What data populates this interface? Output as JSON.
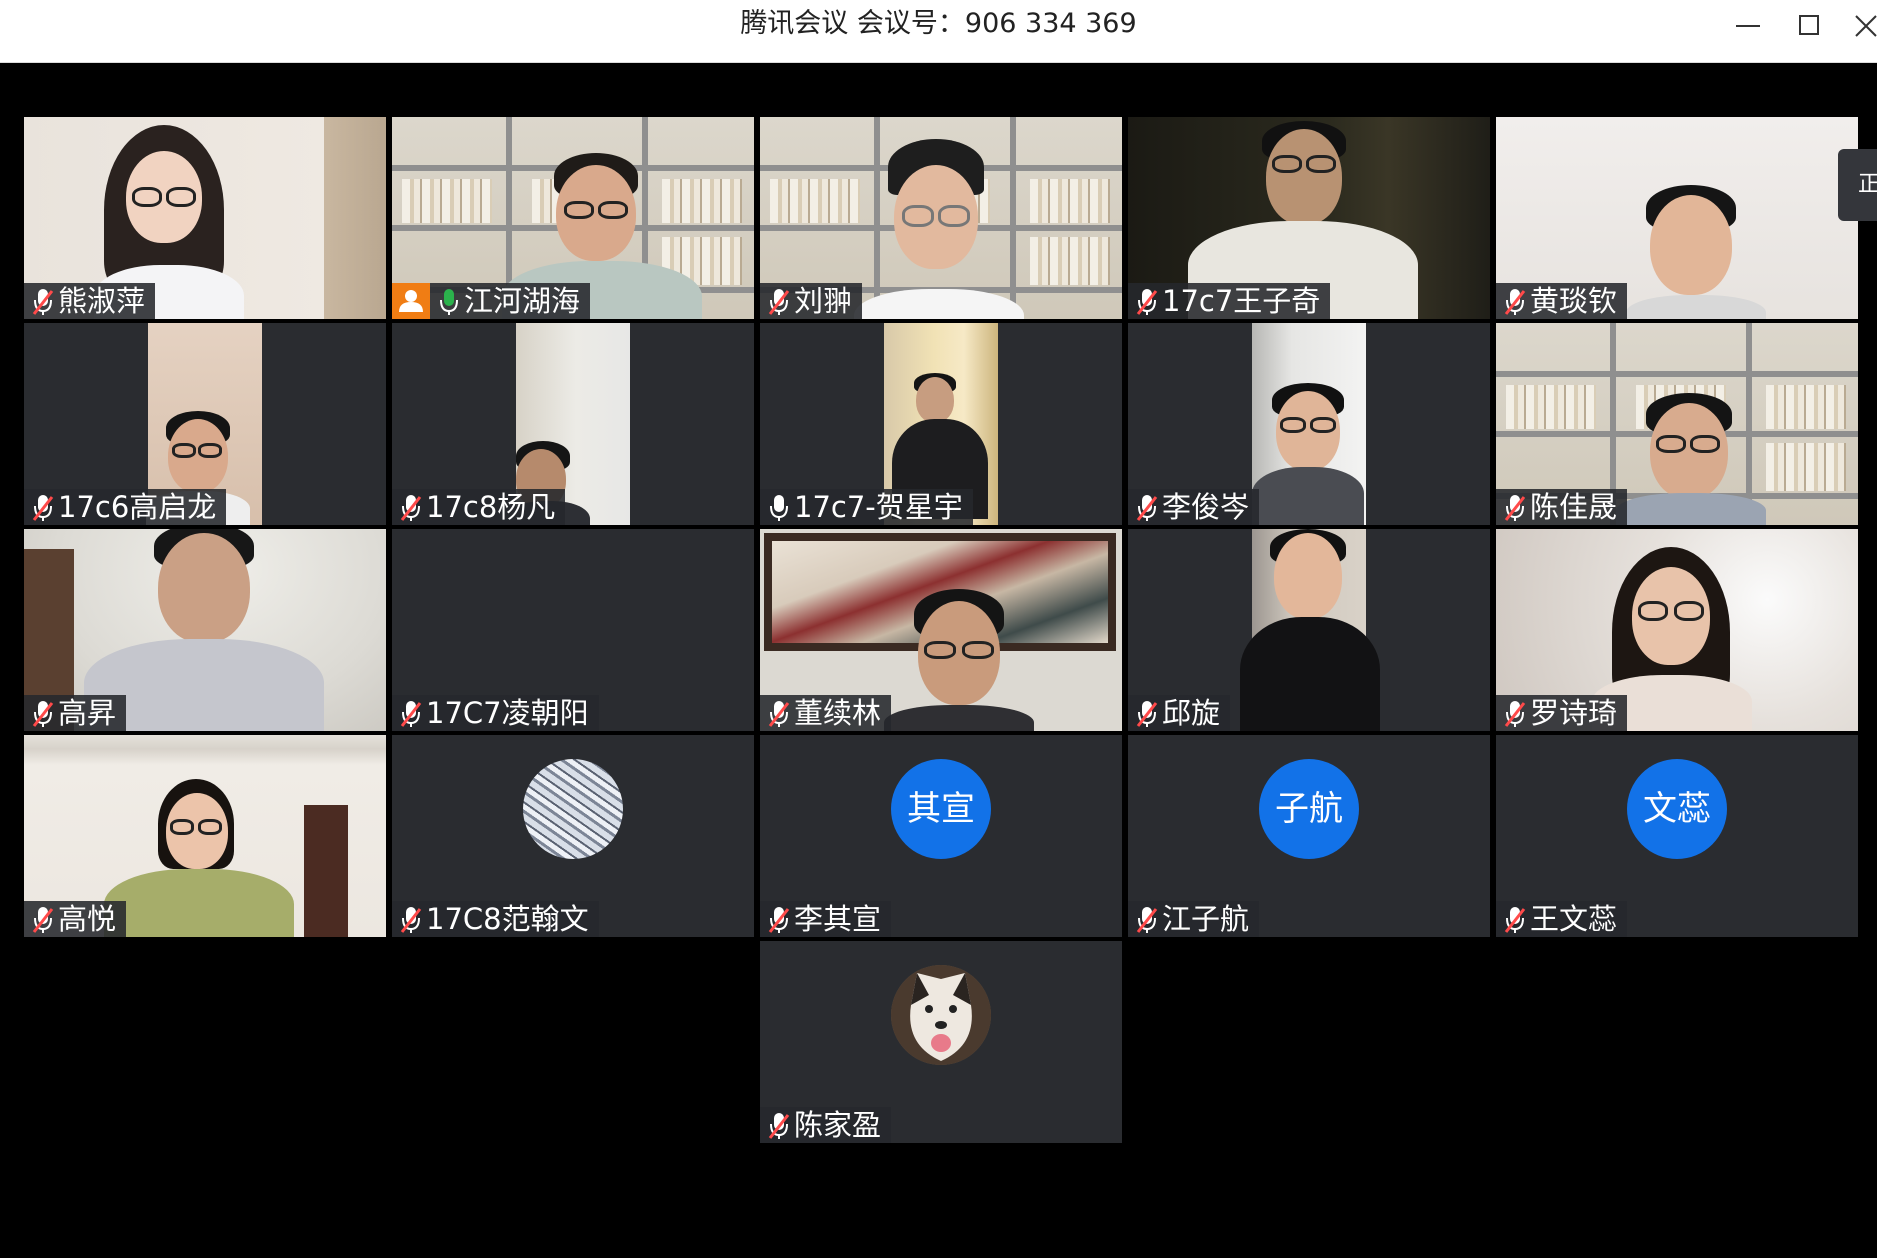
{
  "window": {
    "title": "腾讯会议 会议号：906 334 369",
    "minimize_icon": "minimize-icon",
    "maximize_icon": "maximize-icon",
    "close_icon": "close-icon"
  },
  "side_tab": {
    "label": "正"
  },
  "colors": {
    "tile_bg": "#2a2c30",
    "label_bg": "#26282c",
    "mic_muted": "#ff4a4a",
    "mic_active": "#2bb24c",
    "avatar_blue": "#1272e8",
    "host_orange": "#f07d14",
    "active_border": "#2bb24c"
  },
  "participants": [
    {
      "name": "熊淑萍",
      "mic": "muted"
    },
    {
      "name": "江河湖海",
      "mic": "active",
      "host": true,
      "speaking": true
    },
    {
      "name": "刘翀",
      "mic": "muted"
    },
    {
      "name": "17c7王子奇",
      "mic": "muted"
    },
    {
      "name": "黄琰钦",
      "mic": "muted"
    },
    {
      "name": "17c6高启龙",
      "mic": "muted"
    },
    {
      "name": "17c8杨凡",
      "mic": "muted"
    },
    {
      "name": "17c7-贺星宇",
      "mic": "on"
    },
    {
      "name": "李俊岑",
      "mic": "muted"
    },
    {
      "name": "陈佳晟",
      "mic": "muted"
    },
    {
      "name": "高昇",
      "mic": "muted"
    },
    {
      "name": "17C7凌朝阳",
      "mic": "muted"
    },
    {
      "name": "董续林",
      "mic": "muted"
    },
    {
      "name": "邱旋",
      "mic": "muted"
    },
    {
      "name": "罗诗琦",
      "mic": "muted"
    },
    {
      "name": "高悦",
      "mic": "muted"
    },
    {
      "name": "17C8范翰文",
      "mic": "muted",
      "avatar": "silver-image"
    },
    {
      "name": "李其宣",
      "mic": "muted",
      "avatar_text": "其宣"
    },
    {
      "name": "江子航",
      "mic": "muted",
      "avatar_text": "子航"
    },
    {
      "name": "王文蕊",
      "mic": "muted",
      "avatar_text": "文蕊"
    },
    {
      "name": "陈家盈",
      "mic": "muted",
      "avatar": "dog-image"
    }
  ]
}
